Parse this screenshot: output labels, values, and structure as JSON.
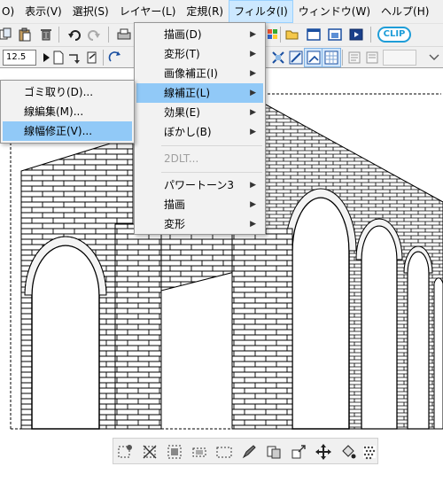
{
  "menubar": {
    "items": [
      {
        "label": "O)"
      },
      {
        "label": "表示(V)"
      },
      {
        "label": "選択(S)"
      },
      {
        "label": "レイヤー(L)"
      },
      {
        "label": "定規(R)"
      },
      {
        "label": "フィルタ(I)"
      },
      {
        "label": "ウィンドウ(W)"
      },
      {
        "label": "ヘルプ(H)"
      }
    ]
  },
  "toolbar": {
    "zoom_value": "12.5",
    "brand_label": "CLIP"
  },
  "filter_menu": {
    "items": [
      {
        "label": "描画(D)"
      },
      {
        "label": "変形(T)"
      },
      {
        "label": "画像補正(I)"
      },
      {
        "label": "線補正(L)"
      },
      {
        "label": "効果(E)"
      },
      {
        "label": "ぼかし(B)"
      },
      {
        "label": "2DLT..."
      },
      {
        "label": "パワートーン3"
      },
      {
        "label": "描画"
      },
      {
        "label": "変形"
      }
    ]
  },
  "line_correction_menu": {
    "items": [
      {
        "label": "ゴミ取り(D)..."
      },
      {
        "label": "線編集(M)..."
      },
      {
        "label": "線幅修正(V)..."
      }
    ]
  },
  "colors": {
    "menu_highlight": "#91c9f7",
    "menubar_active": "#cce8ff",
    "toolbar_bg": "#f0f0f0"
  }
}
